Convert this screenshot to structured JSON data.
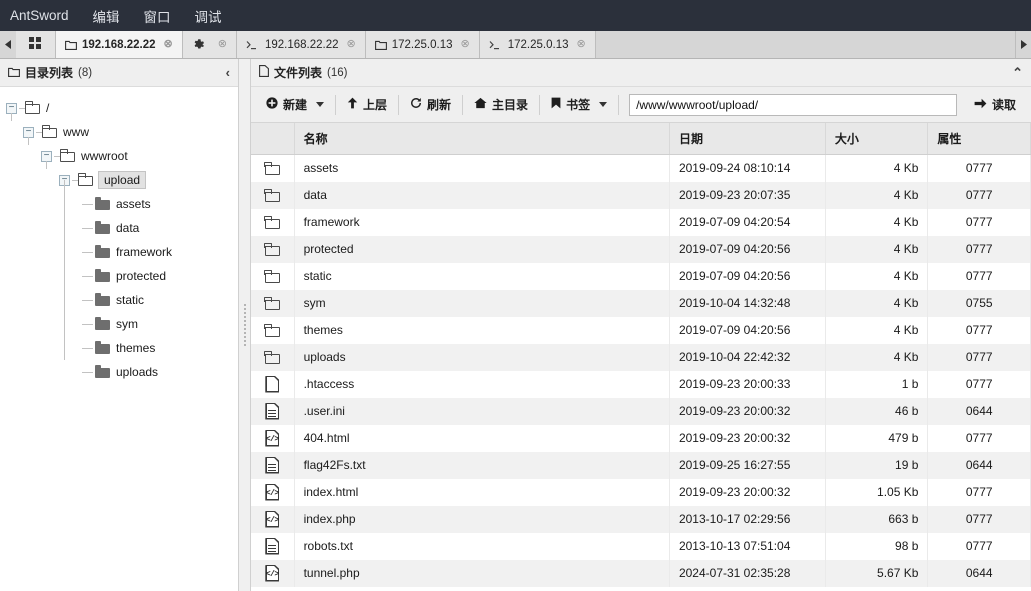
{
  "menubar": {
    "items": [
      {
        "label": "AntSword"
      },
      {
        "label": "编辑"
      },
      {
        "label": "窗口"
      },
      {
        "label": "调试"
      }
    ]
  },
  "tabstrip": {
    "scroll_left": "◀",
    "scroll_right": "▶",
    "grid_icon": "grid-icon",
    "close_glyph": "⊗",
    "tabs": [
      {
        "label": "192.168.22.22",
        "icon": "folder-icon",
        "active": true
      },
      {
        "label": "",
        "icon": "gear-icon",
        "active": false
      },
      {
        "label": "192.168.22.22",
        "icon": "terminal-icon",
        "active": false
      },
      {
        "label": "172.25.0.13",
        "icon": "folder-icon",
        "active": false
      },
      {
        "label": "172.25.0.13",
        "icon": "terminal-icon",
        "active": false
      }
    ]
  },
  "sidebar": {
    "title": "目录列表",
    "count": "(8)",
    "icon": "folder-icon",
    "collapse_icon": "chevron-left-icon",
    "tree": [
      {
        "label": "/",
        "depth": 0,
        "toggle": "−",
        "type": "branch"
      },
      {
        "label": "www",
        "depth": 1,
        "toggle": "−",
        "type": "branch"
      },
      {
        "label": "wwwroot",
        "depth": 2,
        "toggle": "−",
        "type": "branch"
      },
      {
        "label": "upload",
        "depth": 3,
        "toggle": "−",
        "type": "branch",
        "selected": true
      },
      {
        "label": "assets",
        "depth": 4,
        "type": "leaf"
      },
      {
        "label": "data",
        "depth": 4,
        "type": "leaf"
      },
      {
        "label": "framework",
        "depth": 4,
        "type": "leaf"
      },
      {
        "label": "protected",
        "depth": 4,
        "type": "leaf"
      },
      {
        "label": "static",
        "depth": 4,
        "type": "leaf"
      },
      {
        "label": "sym",
        "depth": 4,
        "type": "leaf"
      },
      {
        "label": "themes",
        "depth": 4,
        "type": "leaf"
      },
      {
        "label": "uploads",
        "depth": 4,
        "type": "leaf",
        "last": true
      }
    ]
  },
  "filepanel": {
    "title": "文件列表",
    "count": "(16)",
    "icon": "file-icon",
    "collapse_icon": "chevron-up-icon",
    "toolbar": {
      "new_label": "新建",
      "new_icon": "plus-circle-icon",
      "up_label": "上层",
      "up_icon": "arrow-up-icon",
      "refresh_label": "刷新",
      "refresh_icon": "refresh-icon",
      "home_label": "主目录",
      "home_icon": "home-icon",
      "bookmark_label": "书签",
      "bookmark_icon": "bookmark-icon",
      "read_label": "读取",
      "read_icon": "arrow-right-icon"
    },
    "path_value": "/www/wwwroot/upload/",
    "path_placeholder": "",
    "columns": [
      "",
      "名称",
      "日期",
      "大小",
      "属性"
    ],
    "rows": [
      {
        "icon": "folder",
        "name": "assets",
        "date": "2019-09-24 08:10:14",
        "size": "4 Kb",
        "attr": "0777"
      },
      {
        "icon": "folder",
        "name": "data",
        "date": "2019-09-23 20:07:35",
        "size": "4 Kb",
        "attr": "0777"
      },
      {
        "icon": "folder",
        "name": "framework",
        "date": "2019-07-09 04:20:54",
        "size": "4 Kb",
        "attr": "0777"
      },
      {
        "icon": "folder",
        "name": "protected",
        "date": "2019-07-09 04:20:56",
        "size": "4 Kb",
        "attr": "0777"
      },
      {
        "icon": "folder",
        "name": "static",
        "date": "2019-07-09 04:20:56",
        "size": "4 Kb",
        "attr": "0777"
      },
      {
        "icon": "folder",
        "name": "sym",
        "date": "2019-10-04 14:32:48",
        "size": "4 Kb",
        "attr": "0755"
      },
      {
        "icon": "folder",
        "name": "themes",
        "date": "2019-07-09 04:20:56",
        "size": "4 Kb",
        "attr": "0777"
      },
      {
        "icon": "folder",
        "name": "uploads",
        "date": "2019-10-04 22:42:32",
        "size": "4 Kb",
        "attr": "0777"
      },
      {
        "icon": "plain",
        "name": ".htaccess",
        "date": "2019-09-23 20:00:33",
        "size": "1 b",
        "attr": "0777"
      },
      {
        "icon": "doc",
        "name": ".user.ini",
        "date": "2019-09-23 20:00:32",
        "size": "46 b",
        "attr": "0644"
      },
      {
        "icon": "code",
        "name": "404.html",
        "date": "2019-09-23 20:00:32",
        "size": "479 b",
        "attr": "0777"
      },
      {
        "icon": "doc",
        "name": "flag42Fs.txt",
        "date": "2019-09-25 16:27:55",
        "size": "19 b",
        "attr": "0644"
      },
      {
        "icon": "code",
        "name": "index.html",
        "date": "2019-09-23 20:00:32",
        "size": "1.05 Kb",
        "attr": "0777"
      },
      {
        "icon": "code",
        "name": "index.php",
        "date": "2013-10-17 02:29:56",
        "size": "663 b",
        "attr": "0777"
      },
      {
        "icon": "doc",
        "name": "robots.txt",
        "date": "2013-10-13 07:51:04",
        "size": "98 b",
        "attr": "0777"
      },
      {
        "icon": "code",
        "name": "tunnel.php",
        "date": "2024-07-31 02:35:28",
        "size": "5.67 Kb",
        "attr": "0644"
      }
    ]
  },
  "colors": {
    "menubar_bg": "#2b303b",
    "menubar_text": "#dfe2e8",
    "panel_header_bg": "#efefef",
    "row_stripe": "#f1f1f1"
  }
}
